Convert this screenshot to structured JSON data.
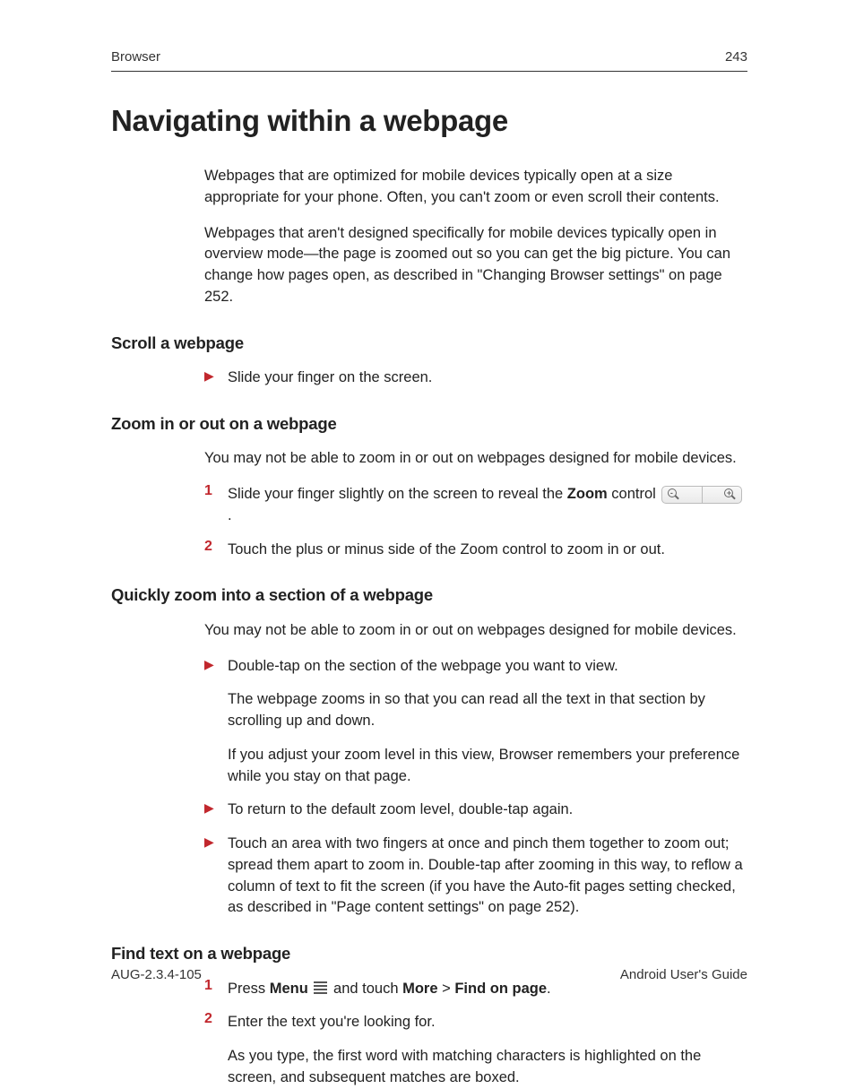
{
  "header": {
    "section": "Browser",
    "page": "243"
  },
  "title": "Navigating within a webpage",
  "intro": {
    "p1": "Webpages that are optimized for mobile devices typically open at a size appropriate for your phone. Often, you can't zoom or even scroll their contents.",
    "p2": "Webpages that aren't designed specifically for mobile devices typically open in overview mode—the page is zoomed out so you can get the big picture. You can change how pages open, as described in \"Changing Browser settings\" on page 252."
  },
  "sections": {
    "scroll": {
      "heading": "Scroll a webpage",
      "item1": "Slide your finger on the screen."
    },
    "zoom": {
      "heading": "Zoom in or out on a webpage",
      "intro": "You may not be able to zoom in or out on webpages designed for mobile devices.",
      "step1_pre": "Slide your finger slightly on the screen to reveal the ",
      "step1_bold": "Zoom",
      "step1_post": " control ",
      "step1_end": ".",
      "step2": "Touch the plus or minus side of the Zoom control to zoom in or out."
    },
    "quick": {
      "heading": "Quickly zoom into a section of a webpage",
      "intro": "You may not be able to zoom in or out on webpages designed for mobile devices.",
      "b1": "Double-tap on the section of the webpage you want to view.",
      "b1_p1": "The webpage zooms in so that you can read all the text in that section by scrolling up and down.",
      "b1_p2": "If you adjust your zoom level in this view, Browser remembers your preference while you stay on that page.",
      "b2": "To return to the default zoom level, double-tap again.",
      "b3": "Touch an area with two fingers at once and pinch them together to zoom out; spread them apart to zoom in. Double-tap after zooming in this way, to reflow a column of text to fit the screen (if you have the Auto-fit pages setting checked, as described in \"Page content settings\" on page 252)."
    },
    "find": {
      "heading": "Find text on a webpage",
      "s1_a": "Press ",
      "s1_b": "Menu",
      "s1_c": " and touch ",
      "s1_d": "More",
      "s1_e": " > ",
      "s1_f": "Find on page",
      "s1_g": ".",
      "s2": "Enter the text you're looking for.",
      "s2_p": "As you type, the first word with matching characters is highlighted on the screen, and subsequent matches are boxed."
    }
  },
  "footer": {
    "left": "AUG-2.3.4-105",
    "right": "Android User's Guide"
  }
}
